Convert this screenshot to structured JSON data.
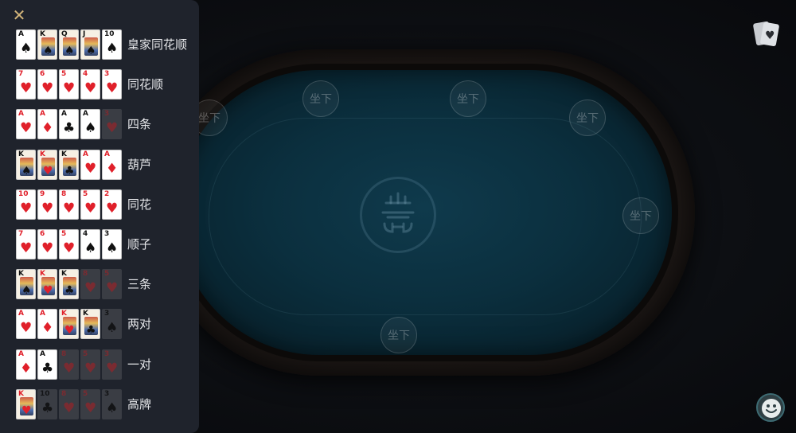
{
  "panel": {
    "close_icon": "close-icon",
    "hands": [
      {
        "label": "皇家同花顺",
        "cards": [
          {
            "rank": "A",
            "suit": "♠",
            "color": "black",
            "face": false,
            "dim": false
          },
          {
            "rank": "K",
            "suit": "♠",
            "color": "black",
            "face": true,
            "dim": false
          },
          {
            "rank": "Q",
            "suit": "♠",
            "color": "black",
            "face": true,
            "dim": false
          },
          {
            "rank": "J",
            "suit": "♠",
            "color": "black",
            "face": true,
            "dim": false
          },
          {
            "rank": "10",
            "suit": "♠",
            "color": "black",
            "face": false,
            "dim": false
          }
        ]
      },
      {
        "label": "同花顺",
        "cards": [
          {
            "rank": "7",
            "suit": "♥",
            "color": "red",
            "face": false,
            "dim": false
          },
          {
            "rank": "6",
            "suit": "♥",
            "color": "red",
            "face": false,
            "dim": false
          },
          {
            "rank": "5",
            "suit": "♥",
            "color": "red",
            "face": false,
            "dim": false
          },
          {
            "rank": "4",
            "suit": "♥",
            "color": "red",
            "face": false,
            "dim": false
          },
          {
            "rank": "3",
            "suit": "♥",
            "color": "red",
            "face": false,
            "dim": false
          }
        ]
      },
      {
        "label": "四条",
        "cards": [
          {
            "rank": "A",
            "suit": "♥",
            "color": "red",
            "face": false,
            "dim": false
          },
          {
            "rank": "A",
            "suit": "♦",
            "color": "red",
            "face": false,
            "dim": false
          },
          {
            "rank": "A",
            "suit": "♣",
            "color": "black",
            "face": false,
            "dim": false
          },
          {
            "rank": "A",
            "suit": "♠",
            "color": "black",
            "face": false,
            "dim": false
          },
          {
            "rank": "3",
            "suit": "♥",
            "color": "red",
            "face": false,
            "dim": true
          }
        ]
      },
      {
        "label": "葫芦",
        "cards": [
          {
            "rank": "K",
            "suit": "♠",
            "color": "black",
            "face": true,
            "dim": false
          },
          {
            "rank": "K",
            "suit": "♥",
            "color": "red",
            "face": true,
            "dim": false
          },
          {
            "rank": "K",
            "suit": "♣",
            "color": "black",
            "face": true,
            "dim": false
          },
          {
            "rank": "A",
            "suit": "♥",
            "color": "red",
            "face": false,
            "dim": false
          },
          {
            "rank": "A",
            "suit": "♦",
            "color": "red",
            "face": false,
            "dim": false
          }
        ]
      },
      {
        "label": "同花",
        "cards": [
          {
            "rank": "10",
            "suit": "♥",
            "color": "red",
            "face": false,
            "dim": false
          },
          {
            "rank": "9",
            "suit": "♥",
            "color": "red",
            "face": false,
            "dim": false
          },
          {
            "rank": "8",
            "suit": "♥",
            "color": "red",
            "face": false,
            "dim": false
          },
          {
            "rank": "5",
            "suit": "♥",
            "color": "red",
            "face": false,
            "dim": false
          },
          {
            "rank": "2",
            "suit": "♥",
            "color": "red",
            "face": false,
            "dim": false
          }
        ]
      },
      {
        "label": "顺子",
        "cards": [
          {
            "rank": "7",
            "suit": "♥",
            "color": "red",
            "face": false,
            "dim": false
          },
          {
            "rank": "6",
            "suit": "♥",
            "color": "red",
            "face": false,
            "dim": false
          },
          {
            "rank": "5",
            "suit": "♥",
            "color": "red",
            "face": false,
            "dim": false
          },
          {
            "rank": "4",
            "suit": "♠",
            "color": "black",
            "face": false,
            "dim": false
          },
          {
            "rank": "3",
            "suit": "♠",
            "color": "black",
            "face": false,
            "dim": false
          }
        ]
      },
      {
        "label": "三条",
        "cards": [
          {
            "rank": "K",
            "suit": "♠",
            "color": "black",
            "face": true,
            "dim": false
          },
          {
            "rank": "K",
            "suit": "♥",
            "color": "red",
            "face": true,
            "dim": false
          },
          {
            "rank": "K",
            "suit": "♣",
            "color": "black",
            "face": true,
            "dim": false
          },
          {
            "rank": "8",
            "suit": "♥",
            "color": "red",
            "face": false,
            "dim": true
          },
          {
            "rank": "5",
            "suit": "♥",
            "color": "red",
            "face": false,
            "dim": true
          }
        ]
      },
      {
        "label": "两对",
        "cards": [
          {
            "rank": "A",
            "suit": "♥",
            "color": "red",
            "face": false,
            "dim": false
          },
          {
            "rank": "A",
            "suit": "♦",
            "color": "red",
            "face": false,
            "dim": false
          },
          {
            "rank": "K",
            "suit": "♥",
            "color": "red",
            "face": true,
            "dim": false
          },
          {
            "rank": "K",
            "suit": "♣",
            "color": "black",
            "face": true,
            "dim": false
          },
          {
            "rank": "3",
            "suit": "♠",
            "color": "black",
            "face": false,
            "dim": true
          }
        ]
      },
      {
        "label": "一对",
        "cards": [
          {
            "rank": "A",
            "suit": "♦",
            "color": "red",
            "face": false,
            "dim": false
          },
          {
            "rank": "A",
            "suit": "♣",
            "color": "black",
            "face": false,
            "dim": false
          },
          {
            "rank": "8",
            "suit": "♥",
            "color": "red",
            "face": false,
            "dim": true
          },
          {
            "rank": "5",
            "suit": "♥",
            "color": "red",
            "face": false,
            "dim": true
          },
          {
            "rank": "3",
            "suit": "♥",
            "color": "red",
            "face": false,
            "dim": true
          }
        ]
      },
      {
        "label": "高牌",
        "cards": [
          {
            "rank": "K",
            "suit": "♥",
            "color": "red",
            "face": true,
            "dim": false
          },
          {
            "rank": "10",
            "suit": "♣",
            "color": "black",
            "face": false,
            "dim": true
          },
          {
            "rank": "8",
            "suit": "♥",
            "color": "red",
            "face": false,
            "dim": true
          },
          {
            "rank": "5",
            "suit": "♥",
            "color": "red",
            "face": false,
            "dim": true
          },
          {
            "rank": "3",
            "suit": "♠",
            "color": "black",
            "face": false,
            "dim": true
          }
        ]
      }
    ]
  },
  "table": {
    "seat_label": "坐下",
    "seats": [
      "坐下",
      "坐下",
      "坐下",
      "坐下",
      "坐下",
      "坐下"
    ],
    "logo_icon": "table-logo-icon",
    "felt_color": "#0b2f3e"
  },
  "topbar": {
    "cards_icon": "cards-icon"
  },
  "bottom": {
    "emoji_icon": "smiley-icon"
  }
}
